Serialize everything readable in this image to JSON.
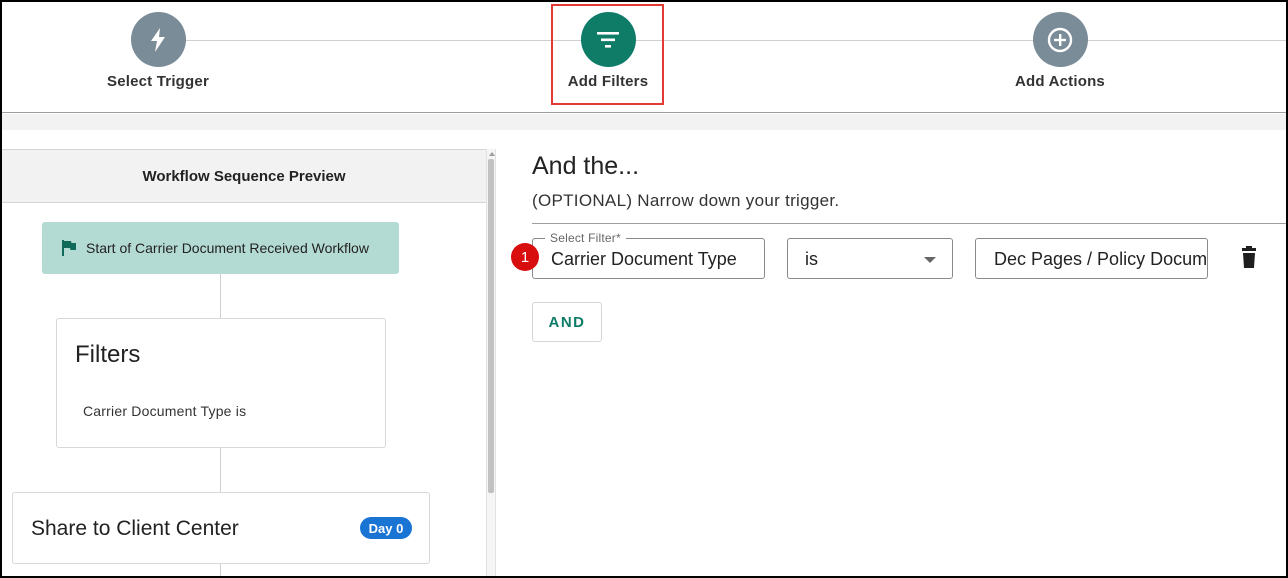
{
  "stepper": {
    "steps": [
      {
        "label": "Select Trigger",
        "icon": "lightning-icon",
        "state": "inactive"
      },
      {
        "label": "Add Filters",
        "icon": "filter-icon",
        "state": "active"
      },
      {
        "label": "Add Actions",
        "icon": "plus-circle-icon",
        "state": "inactive"
      }
    ]
  },
  "preview": {
    "header": "Workflow Sequence Preview",
    "start_label": "Start of Carrier Document Received Workflow",
    "filters_title": "Filters",
    "filters_summary": "Carrier Document Type is",
    "share_title": "Share to Client Center",
    "share_badge": "Day 0"
  },
  "filters_panel": {
    "title": "And the...",
    "subtitle": "(OPTIONAL) Narrow down your trigger.",
    "row": {
      "step_number": "1",
      "filter_label": "Select Filter*",
      "filter_value": "Carrier Document Type",
      "operator_value": "is",
      "value_text": "Dec Pages / Policy Documents"
    },
    "and_button": "AND"
  },
  "colors": {
    "accent": "#0f7c68",
    "inactive_step": "#7a8c98",
    "start_box": "#b4dbd3",
    "badge_blue": "#1a74d4",
    "annotation_red": "#d80d0d"
  }
}
